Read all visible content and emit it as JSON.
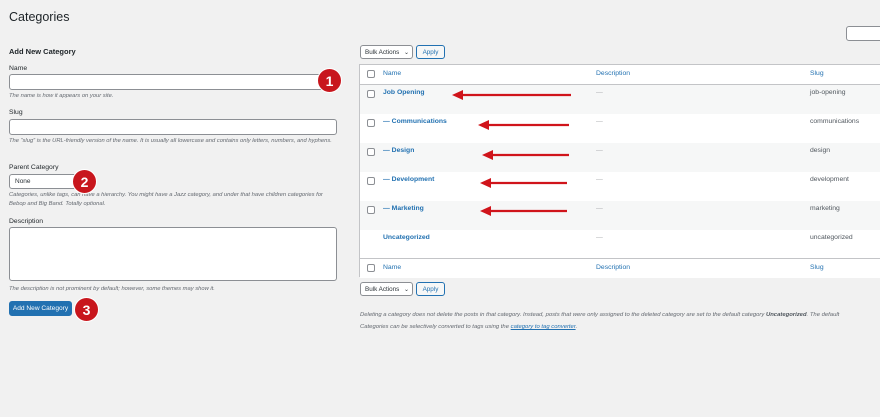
{
  "page": {
    "title": "Categories"
  },
  "form": {
    "heading": "Add New Category",
    "name_label": "Name",
    "name_help": "The name is how it appears on your site.",
    "slug_label": "Slug",
    "slug_help": "The “slug” is the URL-friendly version of the name. It is usually all lowercase and contains only letters, numbers, and hyphens.",
    "parent_label": "Parent Category",
    "parent_selected": "None",
    "parent_help": "Categories, unlike tags, can have a hierarchy. You might have a Jazz category, and under that have children categories for Bebop and Big Band. Totally optional.",
    "desc_label": "Description",
    "desc_help": "The description is not prominent by default; however, some themes may show it.",
    "submit_label": "Add New Category"
  },
  "badges": [
    "1",
    "2",
    "3"
  ],
  "bulk": {
    "select_label": "Bulk Actions",
    "apply_label": "Apply"
  },
  "table": {
    "columns": [
      "Name",
      "Description",
      "Slug"
    ],
    "rows": [
      {
        "name": "Job Opening",
        "description": "—",
        "slug": "job-opening"
      },
      {
        "name": "— Communications",
        "description": "—",
        "slug": "communications"
      },
      {
        "name": "— Design",
        "description": "—",
        "slug": "design"
      },
      {
        "name": "— Development",
        "description": "—",
        "slug": "development"
      },
      {
        "name": "— Marketing",
        "description": "—",
        "slug": "marketing"
      },
      {
        "name": "Uncategorized",
        "description": "—",
        "slug": "uncategorized"
      }
    ]
  },
  "footer": {
    "note_1": "Deleting a category does not delete the posts in that category. Instead, posts that were only assigned to the deleted category are set to the default category",
    "note_bold": "Uncategorized",
    "note_2": ". The default",
    "note_3": "Categories can be selectively converted to tags using the",
    "note_link": "category to tag converter",
    "note_4": "."
  },
  "colors": {
    "accent": "#2271b1",
    "badge": "#c8161d",
    "arrow": "#d0141b"
  }
}
